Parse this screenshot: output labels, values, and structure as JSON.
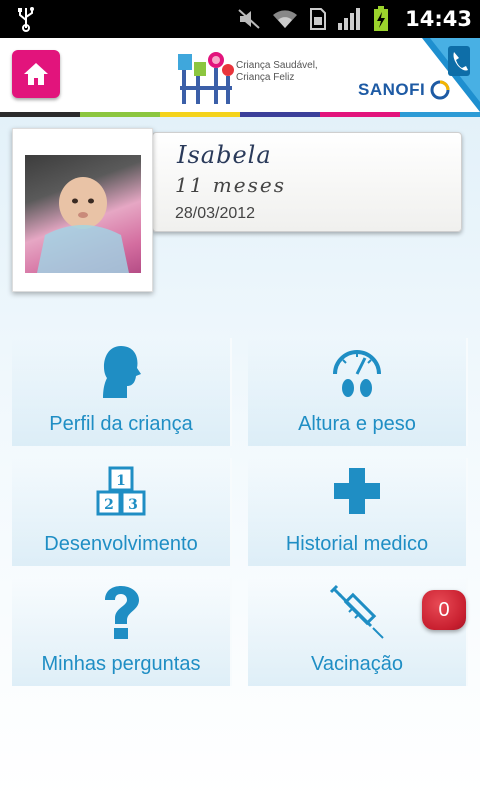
{
  "status_bar": {
    "time": "14:43",
    "icons": [
      "usb-icon",
      "mute-icon",
      "wifi-icon",
      "sim-icon",
      "signal-icon",
      "battery-charging-icon"
    ]
  },
  "header": {
    "home_icon": "home-icon",
    "logo_text_line1": "Criança Saudável,",
    "logo_text_line2": "Criança Feliz",
    "brand": "SANOFI",
    "phone_icon": "phone-icon"
  },
  "colors": {
    "accent_pink": "#e2147c",
    "accent_blue": "#1f8ec4",
    "bar": [
      "#2b2b2b",
      "#8cc63f",
      "#f4d31c",
      "#3b3f9a",
      "#e2147c",
      "#2c9bd6"
    ]
  },
  "profile": {
    "name": "Isabela",
    "age": "11 meses",
    "date": "28/03/2012"
  },
  "menu": [
    {
      "label": "Perfil da criança",
      "icon": "child-profile-icon"
    },
    {
      "label": "Altura e peso",
      "icon": "scale-icon"
    },
    {
      "label": "Desenvolvimento",
      "icon": "blocks-icon",
      "blocks": [
        "1",
        "2",
        "3"
      ]
    },
    {
      "label": "Historial medico",
      "icon": "medical-cross-icon"
    },
    {
      "label": "Minhas perguntas",
      "icon": "question-icon"
    },
    {
      "label": "Vacinação",
      "icon": "syringe-icon"
    }
  ],
  "vaccination_badge": "0"
}
